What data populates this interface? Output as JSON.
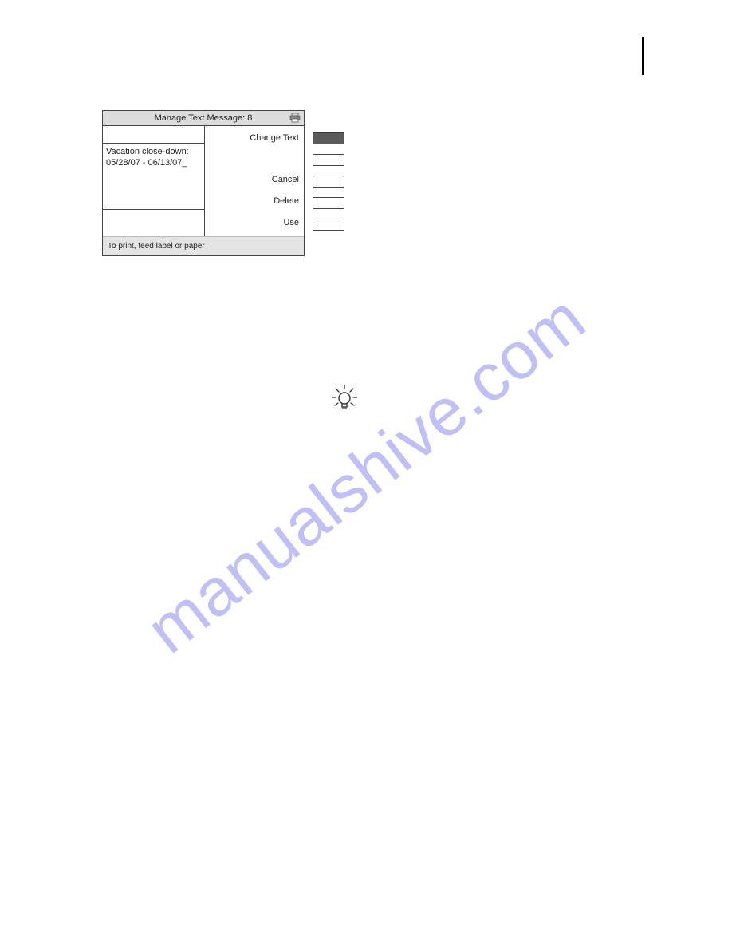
{
  "watermark": "manualshive.com",
  "dialog": {
    "title": "Manage Text Message: 8",
    "message_line1": "Vacation close-down:",
    "message_line2": "05/28/07 - 06/13/07_",
    "labels": {
      "change_text": "Change Text",
      "cancel": "Cancel",
      "delete": "Delete",
      "use": "Use"
    },
    "footer": "To print, feed label or paper"
  }
}
